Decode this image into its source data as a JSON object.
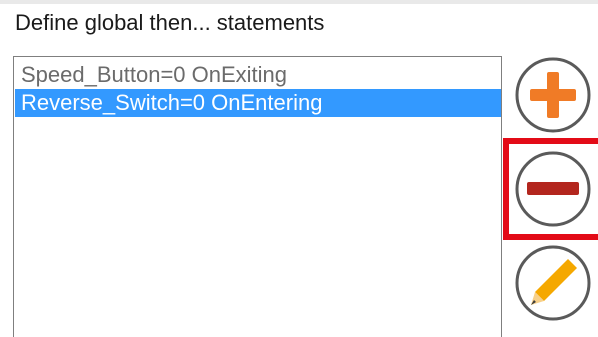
{
  "section": {
    "title": "Define global then... statements"
  },
  "statements": {
    "items": [
      {
        "label": "Speed_Button=0 OnExiting",
        "selected": false
      },
      {
        "label": "Reverse_Switch=0 OnEntering",
        "selected": true
      }
    ]
  },
  "buttons": {
    "add": {
      "icon": "plus-icon",
      "color": "#f07b26"
    },
    "remove": {
      "icon": "minus-icon",
      "color": "#b3261e",
      "highlighted": true
    },
    "edit": {
      "icon": "pencil-icon",
      "color": "#f5a800"
    }
  },
  "colors": {
    "selection": "#3399ff",
    "highlight_frame": "#e30b17",
    "button_ring": "#5a5a5a"
  }
}
